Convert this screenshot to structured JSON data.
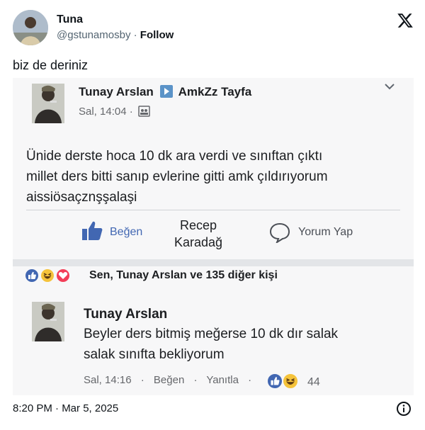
{
  "tweet": {
    "user_name": "Tuna",
    "handle": "@gstunamosby",
    "separator": " · ",
    "follow_label": "Follow",
    "text": "biz de deriniz",
    "timestamp": "8:20 PM · Mar 5, 2025",
    "icons": [
      "x-logo-icon",
      "info-icon",
      "avatar"
    ]
  },
  "facebook_post": {
    "author": "Tunay Arslan",
    "group": "AmkZz Tayfa",
    "meta": "Sal, 14:04 ·",
    "body_lines": [
      "Ünide derste hoca 10 dk ara verdi ve sınıftan çıktı",
      "millet ders bitti sanıp evlerine gitti amk çıldırıyorum",
      "aissiösaçznşşalaşi"
    ],
    "actions": {
      "like_label": "Beğen",
      "middle_label_line1": "Recep",
      "middle_label_line2": "Karadağ",
      "comment_label": "Yorum Yap"
    },
    "reactions_text": "Sen, Tunay Arslan ve 135 diğer kişi",
    "colors": {
      "like_blue": "#4267b2",
      "haha_yellow": "#f5c33b",
      "love_red": "#f33e58"
    }
  },
  "comment": {
    "author": "Tunay Arslan",
    "body_lines": [
      "Beyler ders bitmiş meğerse 10 dk dır salak",
      "salak sınıfta bekliyorum"
    ],
    "time": "Sal, 14:16",
    "dot": "·",
    "like_label": "Beğen",
    "reply_label": "Yanıtla",
    "reaction_count": "44"
  }
}
